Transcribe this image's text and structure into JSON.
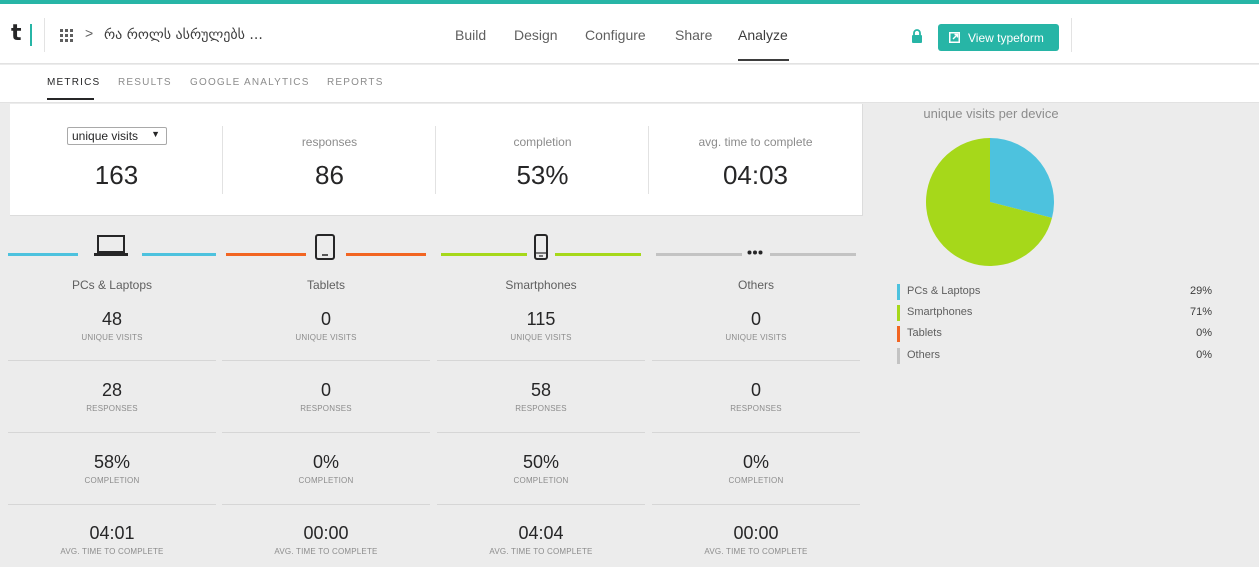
{
  "header": {
    "logo": "t",
    "form_title": "რა როლს ასრულებს ...",
    "nav": [
      "Build",
      "Design",
      "Configure",
      "Share",
      "Analyze"
    ],
    "active_nav": "Analyze",
    "view_button": "View typeform"
  },
  "subtabs": [
    "METRICS",
    "RESULTS",
    "GOOGLE ANALYTICS",
    "REPORTS"
  ],
  "summary": {
    "select_value": "unique visits",
    "cells": [
      {
        "label": "unique visits",
        "value": "163"
      },
      {
        "label": "responses",
        "value": "86"
      },
      {
        "label": "completion",
        "value": "53%"
      },
      {
        "label": "avg. time to complete",
        "value": "04:03"
      }
    ]
  },
  "devices": [
    {
      "name": "PCs & Laptops",
      "color": "#4dc2de",
      "icon": "laptop-icon",
      "unique_visits": "48",
      "responses": "28",
      "completion": "58%",
      "avg_time": "04:01"
    },
    {
      "name": "Tablets",
      "color": "#f26522",
      "icon": "tablet-icon",
      "unique_visits": "0",
      "responses": "0",
      "completion": "0%",
      "avg_time": "00:00"
    },
    {
      "name": "Smartphones",
      "color": "#a6d81a",
      "icon": "smartphone-icon",
      "unique_visits": "115",
      "responses": "58",
      "completion": "50%",
      "avg_time": "04:04"
    },
    {
      "name": "Others",
      "color": "#c3c3c3",
      "icon": "more-icon",
      "unique_visits": "0",
      "responses": "0",
      "completion": "0%",
      "avg_time": "00:00"
    }
  ],
  "metric_labels": {
    "unique_visits": "UNIQUE VISITS",
    "responses": "RESPONSES",
    "completion": "COMPLETION",
    "avg_time": "AVG. TIME TO COMPLETE"
  },
  "right_panel": {
    "title": "unique visits per device",
    "legend": [
      {
        "name": "PCs & Laptops",
        "pct": "29%",
        "color": "#4dc2de"
      },
      {
        "name": "Smartphones",
        "pct": "71%",
        "color": "#a6d81a"
      },
      {
        "name": "Tablets",
        "pct": "0%",
        "color": "#f26522"
      },
      {
        "name": "Others",
        "pct": "0%",
        "color": "#c3c3c3"
      }
    ]
  },
  "chart_data": {
    "type": "pie",
    "title": "unique visits per device",
    "categories": [
      "PCs & Laptops",
      "Smartphones",
      "Tablets",
      "Others"
    ],
    "values": [
      29,
      71,
      0,
      0
    ],
    "colors": [
      "#4dc2de",
      "#a6d81a",
      "#f26522",
      "#c3c3c3"
    ]
  },
  "colors": {
    "accent": "#27b5a6",
    "background": "#ececec"
  }
}
